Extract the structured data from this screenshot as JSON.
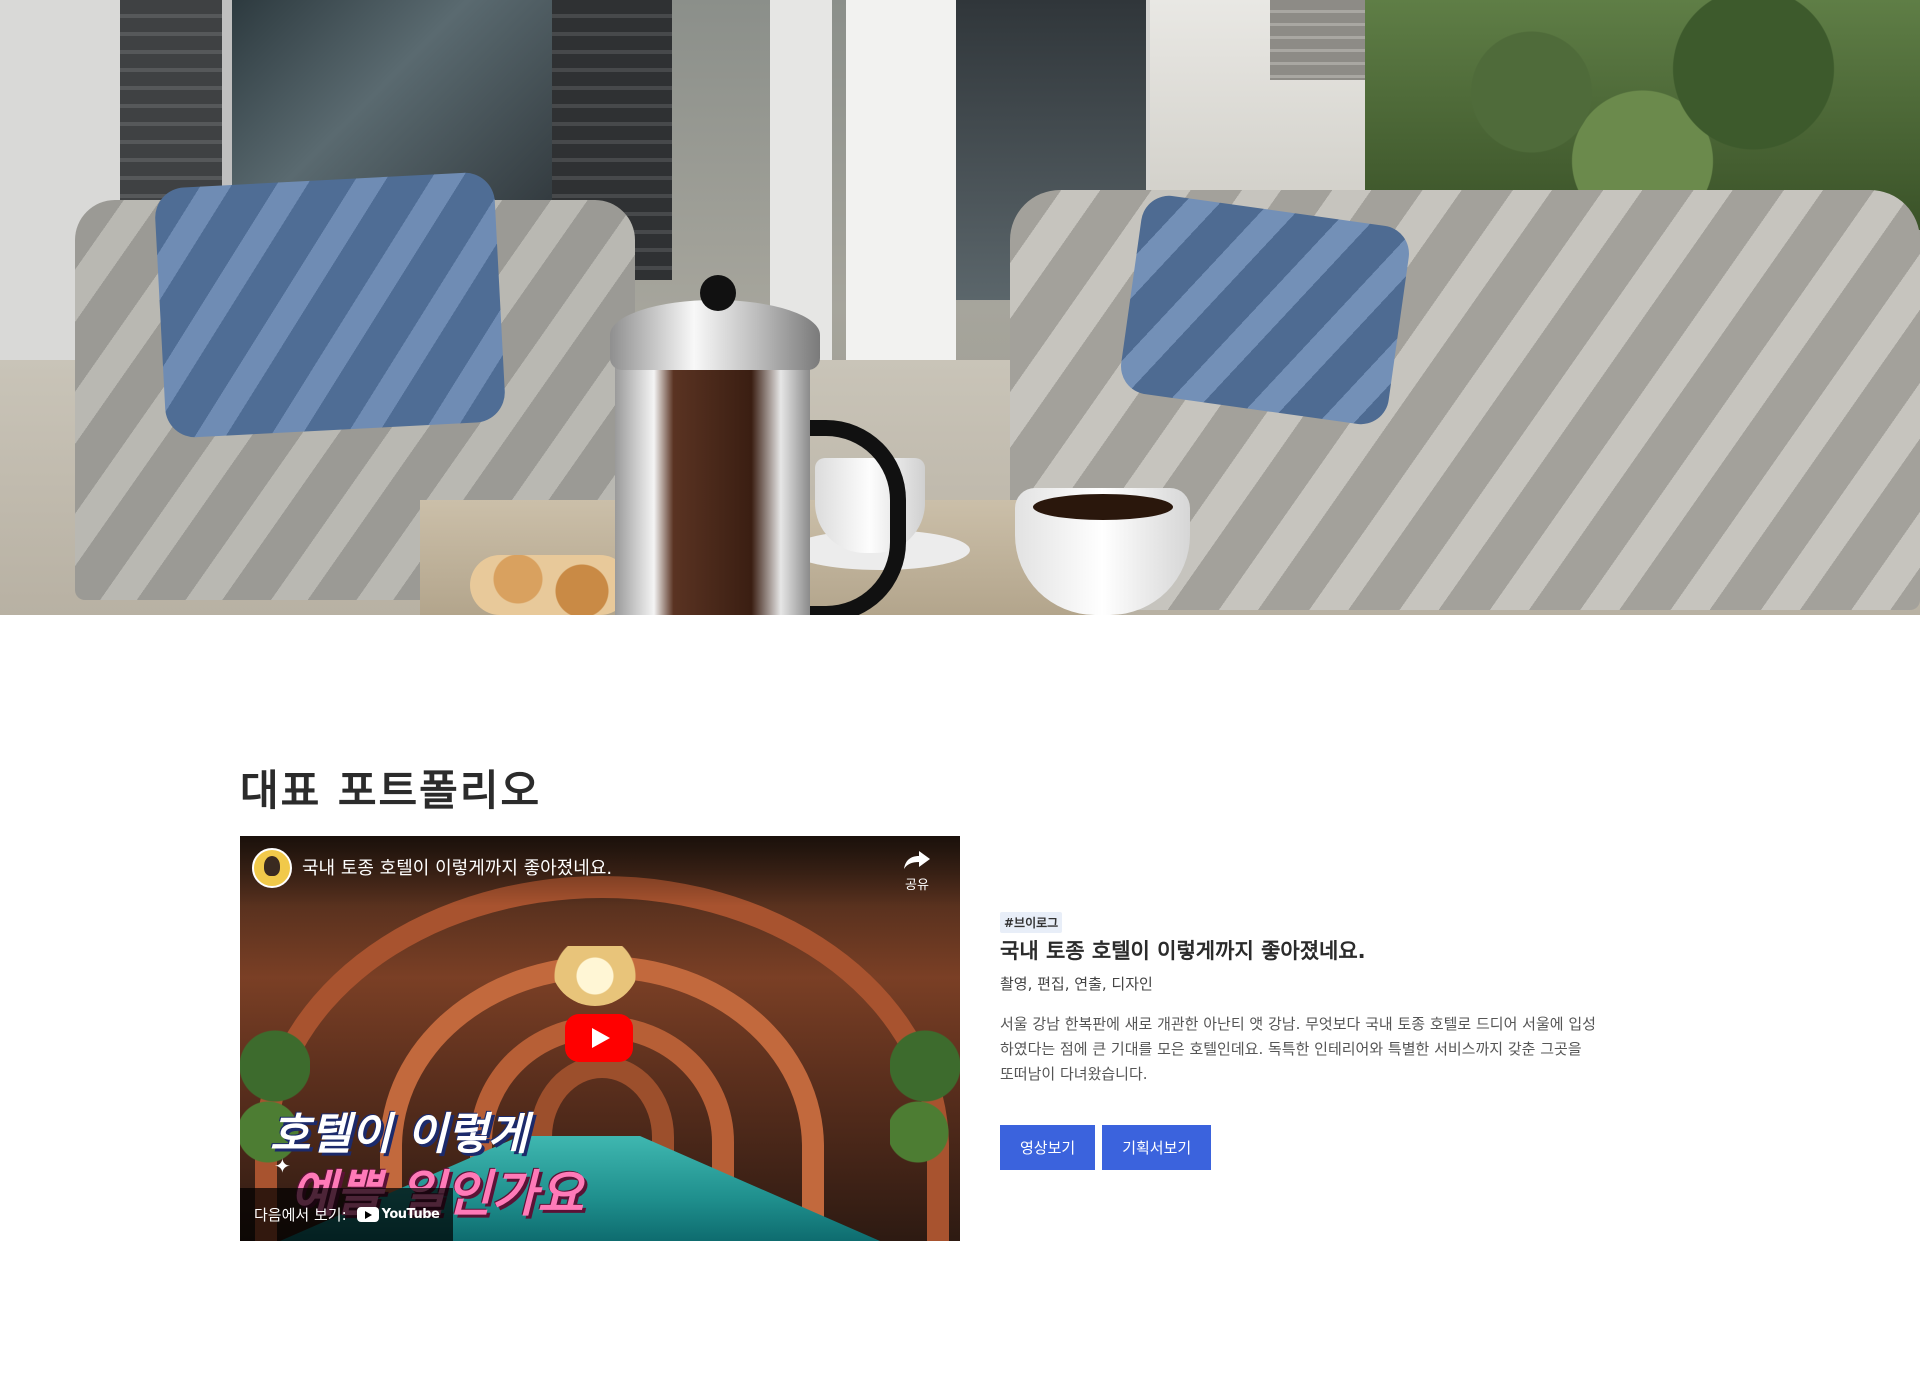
{
  "portfolio": {
    "section_title": "대표 포트폴리오",
    "video": {
      "title": "국내 토종 호텔이 이렇게까지 좋아졌네요.",
      "share_label": "공유",
      "thumbnail_text_line1": "호텔이 이렇게",
      "thumbnail_text_line2": "예쁠 일인가요",
      "watch_on_label": "다음에서 보기:",
      "youtube_label": "YouTube",
      "play_button_color": "#ff0000"
    },
    "item": {
      "tag": "#브이로그",
      "title": "국내 토종 호텔이 이렇게까지 좋아졌네요.",
      "roles": "촬영, 편집, 연출, 디자인",
      "description": "서울 강남 한복판에 새로 개관한 아난티 앳 강남. 무엇보다 국내 토종 호텔로 드디어 서울에 입성하였다는 점에 큰 기대를 모은 호텔인데요. 독특한 인테리어와 특별한 서비스까지 갖춘 그곳을 또떠남이 다녀왔습니다.",
      "buttons": {
        "video": "영상보기",
        "proposal": "기획서보기"
      }
    }
  },
  "colors": {
    "button_bg": "#3b63dd",
    "tag_bg": "#e8eef8",
    "title_text": "#2b2b2b"
  }
}
